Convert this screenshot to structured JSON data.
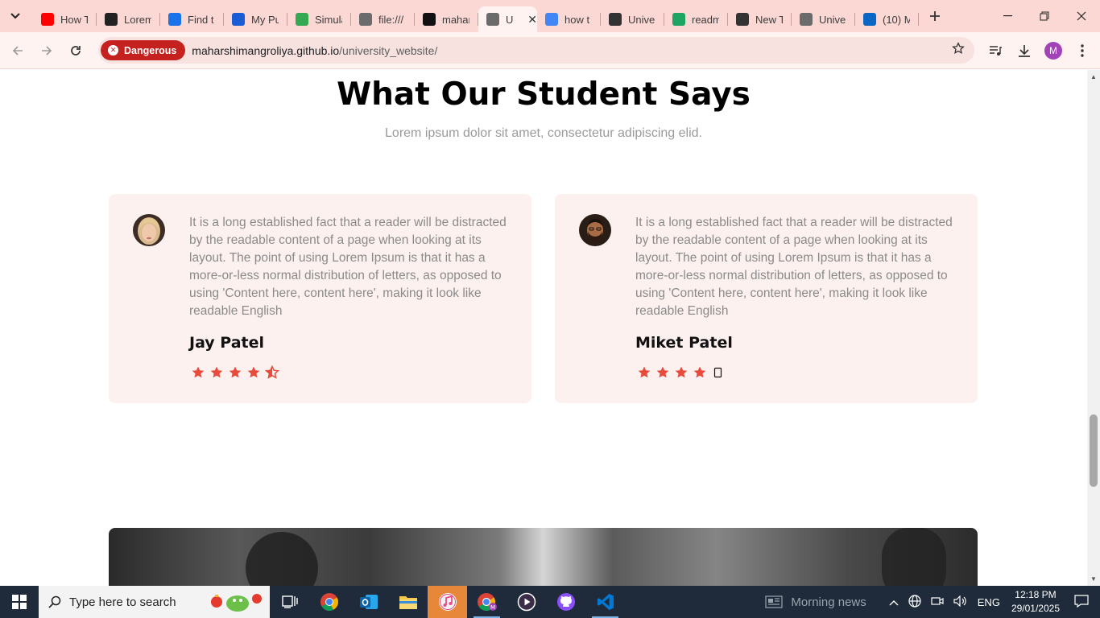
{
  "browser": {
    "tabs": [
      {
        "label": "How T",
        "icon": "youtube-icon",
        "color": "#ff0000"
      },
      {
        "label": "Lorem",
        "icon": "lorem-l-icon",
        "color": "#222222"
      },
      {
        "label": "Find t",
        "icon": "flag-icon",
        "color": "#1a73e8"
      },
      {
        "label": "My Pu",
        "icon": "c-logo-icon",
        "color": "#1a5cd6"
      },
      {
        "label": "Simula",
        "icon": "chrome-icon",
        "color": "#34a853"
      },
      {
        "label": "file:///",
        "icon": "globe-icon",
        "color": "#6b6b6b"
      },
      {
        "label": "mahar",
        "icon": "github-icon",
        "color": "#111111"
      },
      {
        "label": "U",
        "icon": "globe-icon",
        "color": "#6b6b6b",
        "active": true
      },
      {
        "label": "how t",
        "icon": "google-icon",
        "color": "#4285f4"
      },
      {
        "label": "Univer",
        "icon": "openai-icon",
        "color": "#333333"
      },
      {
        "label": "readm",
        "icon": "sheet-icon",
        "color": "#1fa463"
      },
      {
        "label": "New T",
        "icon": "chrome-dark-icon",
        "color": "#333333"
      },
      {
        "label": "Univer",
        "icon": "globe-icon",
        "color": "#6b6b6b"
      },
      {
        "label": "(10) M",
        "icon": "linkedin-icon",
        "color": "#0a66c2"
      }
    ],
    "security_label": "Dangerous",
    "url_host": "maharshimangroliya.github.io",
    "url_path": "/university_website/",
    "profile_initial": "M"
  },
  "page": {
    "heading": "What Our Student Says",
    "subheading": "Lorem ipsum dolor sit amet, consectetur adipiscing elid.",
    "testimonials": [
      {
        "quote": "It is a long established fact that a reader will be distracted by the readable content of a page when looking at its layout. The point of using Lorem Ipsum is that it has a more-or-less normal distribution of letters, as opposed to using 'Content here, content here', making it look like readable English",
        "name": "Jay Patel",
        "rating": 4.5
      },
      {
        "quote": "It is a long established fact that a reader will be distracted by the readable content of a page when looking at its layout. The point of using Lorem Ipsum is that it has a more-or-less normal distribution of letters, as opposed to using 'Content here, content here', making it look like readable English",
        "name": "Miket Patel",
        "rating": 4
      }
    ],
    "star_color": "#e84a3b"
  },
  "taskbar": {
    "search_placeholder": "Type here to search",
    "news": "Morning news",
    "language": "ENG",
    "time": "12:18 PM",
    "date": "29/01/2025"
  }
}
